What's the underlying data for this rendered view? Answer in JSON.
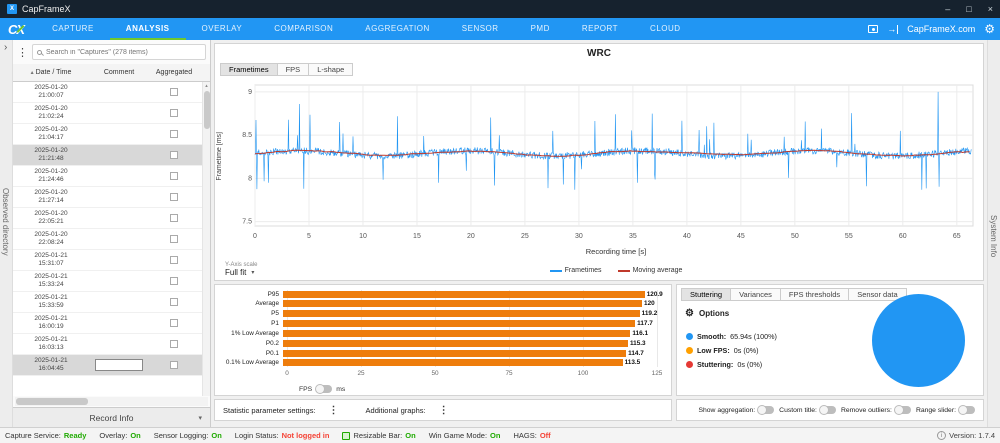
{
  "colors": {
    "titlebar_bg": "#16222e",
    "nav_blue": "#2196f3",
    "accent_green": "#70c72f",
    "bar_orange": "#ee7d0c",
    "pie_blue": "#2196f3",
    "good": "#1faa00",
    "bad": "#f44336"
  },
  "window": {
    "title": "CapFrameX"
  },
  "nav": {
    "tabs": [
      "CAPTURE",
      "ANALYSIS",
      "OVERLAY",
      "COMPARISON",
      "AGGREGATION",
      "SENSOR",
      "PMD",
      "REPORT",
      "CLOUD"
    ],
    "active_tab": "ANALYSIS",
    "website_label": "CapFrameX.com"
  },
  "side_labels": {
    "left": "Observed directory",
    "right": "System Info"
  },
  "sidebar": {
    "search_placeholder": "Search in \"Captures\" (278 items)",
    "columns": {
      "date": "Date / Time",
      "comment": "Comment",
      "aggregated": "Aggregated"
    },
    "records": [
      {
        "date": "2025-01-20",
        "time": "21:00:07",
        "selected": false,
        "editing": false
      },
      {
        "date": "2025-01-20",
        "time": "21:02:24",
        "selected": false,
        "editing": false
      },
      {
        "date": "2025-01-20",
        "time": "21:04:17",
        "selected": false,
        "editing": false
      },
      {
        "date": "2025-01-20",
        "time": "21:21:48",
        "selected": true,
        "editing": false
      },
      {
        "date": "2025-01-20",
        "time": "21:24:46",
        "selected": false,
        "editing": false
      },
      {
        "date": "2025-01-20",
        "time": "21:27:14",
        "selected": false,
        "editing": false
      },
      {
        "date": "2025-01-20",
        "time": "22:05:21",
        "selected": false,
        "editing": false
      },
      {
        "date": "2025-01-20",
        "time": "22:08:24",
        "selected": false,
        "editing": false
      },
      {
        "date": "2025-01-21",
        "time": "15:31:07",
        "selected": false,
        "editing": false
      },
      {
        "date": "2025-01-21",
        "time": "15:33:24",
        "selected": false,
        "editing": false
      },
      {
        "date": "2025-01-21",
        "time": "15:33:59",
        "selected": false,
        "editing": false
      },
      {
        "date": "2025-01-21",
        "time": "16:00:19",
        "selected": false,
        "editing": false
      },
      {
        "date": "2025-01-21",
        "time": "16:03:13",
        "selected": false,
        "editing": false
      },
      {
        "date": "2025-01-21",
        "time": "16:04:45",
        "selected": true,
        "editing": true
      }
    ],
    "record_info_label": "Record Info"
  },
  "analysis": {
    "title": "WRC",
    "tabs": [
      "Frametimes",
      "FPS",
      "L-shape"
    ],
    "active_tab": "Frametimes",
    "yaxis_scale_label": "Y-Axis scale",
    "yaxis_scale_value": "Full fit"
  },
  "chart_data": [
    {
      "id": "frametimes-line",
      "type": "line",
      "title": "WRC",
      "ylabel": "Frametime [ms]",
      "xlabel": "Recording time [s]",
      "ylim": [
        7.5,
        9.0
      ],
      "xlim": [
        0,
        66.5
      ],
      "y_ticks": [
        9,
        8.5,
        8,
        7.5
      ],
      "x_ticks": [
        0,
        5,
        10,
        15,
        20,
        25,
        30,
        35,
        40,
        45,
        50,
        55,
        60,
        65
      ],
      "grid": true,
      "legend_position": "bottom",
      "series": [
        {
          "name": "Frametimes",
          "color": "#2196f3",
          "baseline_ms": 8.3,
          "noise_ms": 0.08,
          "max_spike_ms": 9.0,
          "min_dip_ms": 7.88
        },
        {
          "name": "Moving average",
          "color": "#c0392b",
          "baseline_ms": 8.3
        }
      ]
    },
    {
      "id": "statistic-parameters",
      "type": "bar",
      "orientation": "horizontal",
      "categories": [
        "P95",
        "Average",
        "P5",
        "P1",
        "1% Low Average",
        "P0.2",
        "P0.1",
        "0.1% Low Average"
      ],
      "values": [
        120.9,
        120,
        119.2,
        117.7,
        116.1,
        115.3,
        114.7,
        113.5
      ],
      "xlim": [
        0,
        125
      ],
      "x_ticks": [
        0,
        25,
        50,
        75,
        100,
        125
      ],
      "bar_color": "#ee7d0c",
      "unit_left": "FPS",
      "unit_right": "ms"
    },
    {
      "id": "stuttering-pie",
      "type": "pie",
      "slices": [
        {
          "label": "Smooth",
          "value": 100,
          "color": "#2196f3"
        },
        {
          "label": "Low FPS",
          "value": 0,
          "color": "#ffa000"
        },
        {
          "label": "Stuttering",
          "value": 0,
          "color": "#e53935"
        }
      ]
    }
  ],
  "stutter_panel": {
    "tabs": [
      "Stuttering",
      "Variances",
      "FPS thresholds",
      "Sensor data"
    ],
    "active_tab": "Stuttering",
    "options_label": "Options",
    "legend": [
      {
        "label": "Smooth:",
        "value": "65.94s (100%)",
        "color": "#2196f3"
      },
      {
        "label": "Low FPS:",
        "value": "0s (0%)",
        "color": "#ffa000"
      },
      {
        "label": "Stuttering:",
        "value": "0s (0%)",
        "color": "#e53935"
      }
    ]
  },
  "footer": {
    "stat_settings_label": "Statistic parameter settings:",
    "additional_graphs_label": "Additional graphs:",
    "toggles": [
      {
        "label": "Show aggregation:",
        "on": false
      },
      {
        "label": "Custom title:",
        "on": false
      },
      {
        "label": "Remove outliers:",
        "on": false
      },
      {
        "label": "Range slider:",
        "on": false
      }
    ]
  },
  "status_bar": {
    "items": [
      {
        "label": "Capture Service:",
        "value": "Ready",
        "state": "good",
        "icon": ""
      },
      {
        "label": "Overlay:",
        "value": "On",
        "state": "good",
        "icon": ""
      },
      {
        "label": "Sensor Logging:",
        "value": "On",
        "state": "good",
        "icon": ""
      },
      {
        "label": "Login Status:",
        "value": "Not logged in",
        "state": "bad",
        "icon": ""
      },
      {
        "label": "Resizable Bar:",
        "value": "On",
        "state": "good",
        "icon": "chip-icon"
      },
      {
        "label": "Win Game Mode:",
        "value": "On",
        "state": "good",
        "icon": ""
      },
      {
        "label": "HAGS:",
        "value": "Off",
        "state": "bad",
        "icon": ""
      }
    ],
    "version": "Version: 1.7.4"
  }
}
